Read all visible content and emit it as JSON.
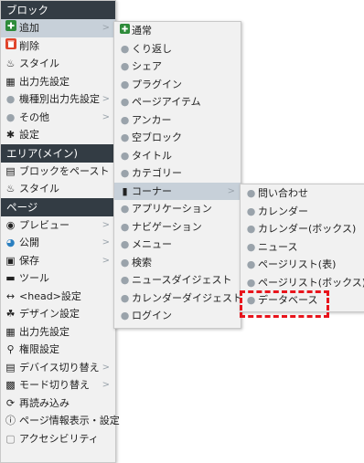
{
  "main": {
    "sections": [
      {
        "header": "ブロック",
        "items": [
          {
            "label": "追加",
            "icon": "plus-icon",
            "arrow": true,
            "highlight": true
          },
          {
            "label": "削除",
            "icon": "delete-icon"
          },
          {
            "label": "スタイル",
            "icon": "paint-bucket-icon"
          },
          {
            "label": "出力先設定",
            "icon": "output-icon"
          },
          {
            "label": "機種別出力先設定",
            "icon": "dot-icon",
            "arrow": true
          },
          {
            "label": "その他",
            "icon": "dot-icon",
            "arrow": true
          },
          {
            "label": "設定",
            "icon": "gear-icon"
          }
        ]
      },
      {
        "header": "エリア(メイン)",
        "items": [
          {
            "label": "ブロックをペースト",
            "icon": "paste-icon"
          },
          {
            "label": "スタイル",
            "icon": "paint-bucket-icon"
          }
        ]
      },
      {
        "header": "ページ",
        "items": [
          {
            "label": "プレビュー",
            "icon": "eye-icon",
            "arrow": true
          },
          {
            "label": "公開",
            "icon": "globe-icon",
            "arrow": true
          },
          {
            "label": "保存",
            "icon": "save-icon",
            "arrow": true
          },
          {
            "label": "ツール",
            "icon": "toolbar-icon"
          },
          {
            "label": "<head>設定",
            "icon": "code-icon"
          },
          {
            "label": "デザイン設定",
            "icon": "design-icon"
          },
          {
            "label": "出力先設定",
            "icon": "output-icon"
          },
          {
            "label": "権限設定",
            "icon": "key-icon"
          },
          {
            "label": "デバイス切り替え",
            "icon": "device-icon",
            "arrow": true
          },
          {
            "label": "モード切り替え",
            "icon": "mode-icon",
            "arrow": true
          },
          {
            "label": "再読み込み",
            "icon": "reload-icon"
          },
          {
            "label": "ページ情報表示・設定",
            "icon": "info-icon"
          },
          {
            "label": "アクセシビリティ",
            "icon": "accessibility-icon"
          }
        ]
      }
    ]
  },
  "submenu_add": {
    "items": [
      {
        "label": "通常",
        "icon": "plus-icon"
      },
      {
        "label": "くり返し",
        "icon": "dot-icon"
      },
      {
        "label": "シェア",
        "icon": "dot-icon"
      },
      {
        "label": "プラグイン",
        "icon": "dot-icon"
      },
      {
        "label": "ページアイテム",
        "icon": "dot-icon"
      },
      {
        "label": "アンカー",
        "icon": "dot-icon"
      },
      {
        "label": "空ブロック",
        "icon": "dot-icon"
      },
      {
        "label": "タイトル",
        "icon": "dot-icon"
      },
      {
        "label": "カテゴリー",
        "icon": "dot-icon"
      },
      {
        "label": "コーナー",
        "icon": "puzzle-icon",
        "arrow": true,
        "highlight": true
      },
      {
        "label": "アプリケーション",
        "icon": "dot-icon"
      },
      {
        "label": "ナビゲーション",
        "icon": "dot-icon"
      },
      {
        "label": "メニュー",
        "icon": "dot-icon"
      },
      {
        "label": "検索",
        "icon": "dot-icon"
      },
      {
        "label": "ニュースダイジェスト",
        "icon": "dot-icon"
      },
      {
        "label": "カレンダーダイジェスト",
        "icon": "dot-icon"
      },
      {
        "label": "ログイン",
        "icon": "dot-icon"
      }
    ]
  },
  "submenu_corner": {
    "items": [
      {
        "label": "問い合わせ"
      },
      {
        "label": "カレンダー"
      },
      {
        "label": "カレンダー(ボックス)"
      },
      {
        "label": "ニュース"
      },
      {
        "label": "ページリスト(表)"
      },
      {
        "label": "ページリスト(ボックス)"
      },
      {
        "label": "データベース"
      }
    ]
  },
  "colors": {
    "header_bg": "#333c44",
    "highlight": "#c7d0d9",
    "annotation": "#e8141c"
  }
}
